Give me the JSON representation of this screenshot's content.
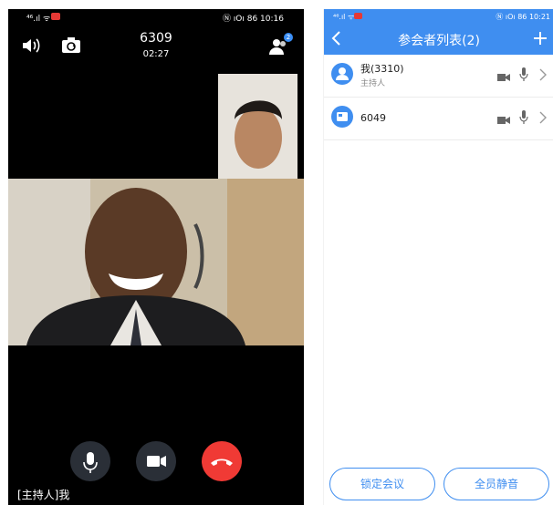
{
  "left": {
    "status": {
      "signal": "⁴⁶.ıl ᯤ",
      "right": "Ⓝ ıՕı 86 10:16"
    },
    "call": {
      "number": "6309",
      "timer": "02:27",
      "participant_badge": "2"
    },
    "host_label": "[主持人]我"
  },
  "right": {
    "status": {
      "signal": "⁴⁶.ıl ᯤ",
      "right": "Ⓝ ıՕı 86 10:21"
    },
    "title": "参会者列表(2)",
    "participants": [
      {
        "name": "我(3310)",
        "role": "主持人"
      },
      {
        "name": "6049",
        "role": ""
      }
    ],
    "buttons": {
      "lock": "锁定会议",
      "mute_all": "全员静音"
    }
  },
  "colors": {
    "accent": "#3f8ef0",
    "hangup": "#f03a35"
  },
  "icons": [
    "speaker-icon",
    "switch-camera-icon",
    "participants-icon",
    "mic-icon",
    "video-icon",
    "hangup-icon",
    "back-icon",
    "add-icon",
    "person-icon",
    "device-icon",
    "chevron-right-icon"
  ]
}
